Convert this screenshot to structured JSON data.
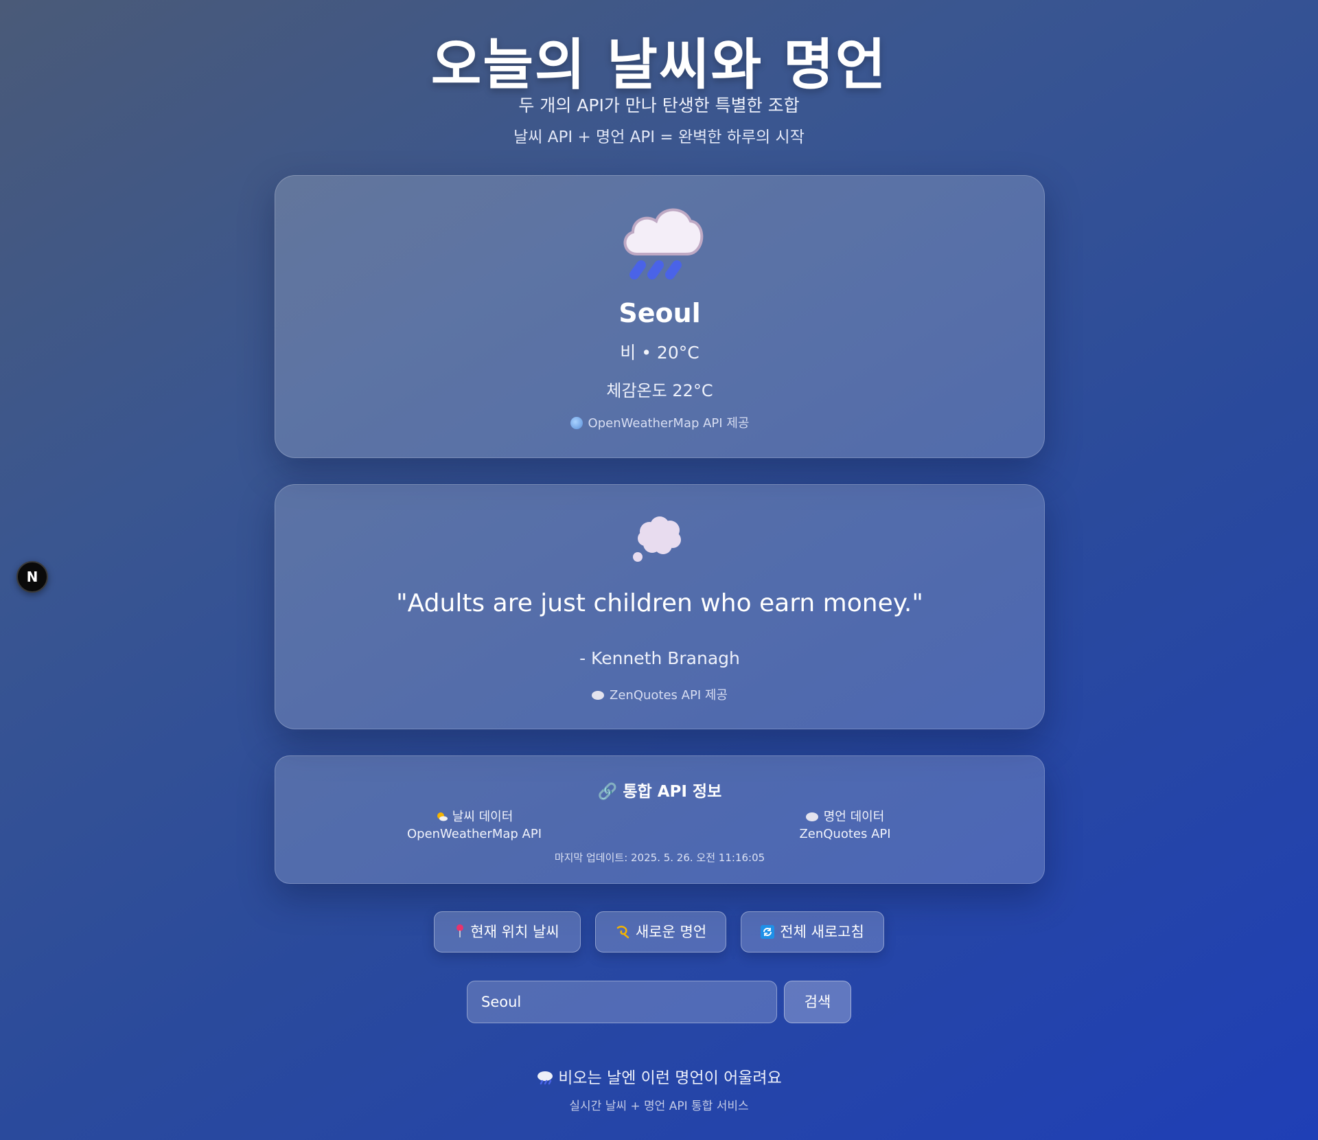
{
  "header": {
    "title": "오늘의 날씨와 명언",
    "subtitle": "두 개의 API가 만나 탄생한 특별한 조합",
    "subtitle2": "날씨 API + 명언 API = 완벽한 하루의 시작"
  },
  "weather": {
    "icon": "rain-cloud-icon",
    "city": "Seoul",
    "condition": "비 • 20°C",
    "feels_like": "체감온도 22°C",
    "provider": "OpenWeatherMap API 제공"
  },
  "quote": {
    "icon": "thought-bubble-icon",
    "text": "\"Adults are just children who earn money.\"",
    "author": "- Kenneth Branagh",
    "provider": "ZenQuotes API 제공"
  },
  "api_info": {
    "title": "🔗 통합 API 정보",
    "weather_label": "날씨 데이터",
    "weather_source": "OpenWeatherMap API",
    "quote_label": "명언 데이터",
    "quote_source": "ZenQuotes API",
    "updated": "마지막 업데이트: 2025. 5. 26. 오전 11:16:05"
  },
  "buttons": {
    "location": "현재 위치 날씨",
    "new_quote": "새로운 명언",
    "refresh_all": "전체 새로고침"
  },
  "search": {
    "value": "Seoul",
    "button": "검색"
  },
  "footer": {
    "message": "비오는 날엔 이런 명언이 어울려요",
    "sub": "실시간 날씨 + 명언 API 통합 서비스"
  },
  "badge": {
    "label": "N"
  },
  "colors": {
    "background_start": "#4a5a78",
    "background_end": "#1f3fb6",
    "rain_drop": "#4a63e8"
  }
}
